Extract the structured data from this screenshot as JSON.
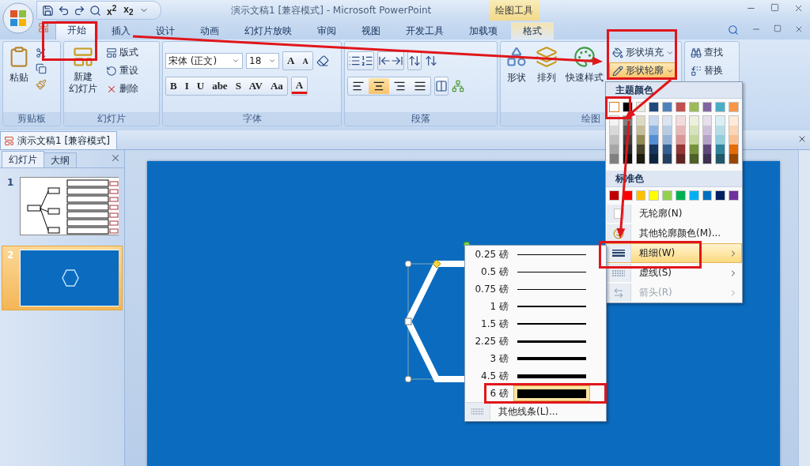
{
  "title_bar": {
    "quick_access": [
      "x$^{2}$",
      "x$_{2}$"
    ],
    "title": "演示文稿1 [兼容模式] - Microsoft PowerPoint",
    "context_group": "绘图工具"
  },
  "tabs": [
    {
      "label": "开始",
      "selected": true
    },
    {
      "label": "插入",
      "selected": false
    },
    {
      "label": "设计",
      "selected": false
    },
    {
      "label": "动画",
      "selected": false
    },
    {
      "label": "幻灯片放映",
      "selected": false
    },
    {
      "label": "审阅",
      "selected": false
    },
    {
      "label": "视图",
      "selected": false
    },
    {
      "label": "开发工具",
      "selected": false
    },
    {
      "label": "加载项",
      "selected": false
    },
    {
      "label": "格式",
      "selected": false,
      "kind": "context"
    }
  ],
  "ribbon": {
    "clipboard": {
      "label": "剪贴板",
      "paste": "粘贴"
    },
    "slides": {
      "label": "幻灯片",
      "new_slide": [
        "新建",
        "幻灯片"
      ],
      "layout": "版式",
      "reset": "重设",
      "delete": "删除"
    },
    "font": {
      "label": "字体",
      "font_name": "宋体 (正文)",
      "font_size": "18",
      "grow": "A",
      "shrink": "A",
      "buttons": [
        "B",
        "I",
        "U",
        "abe",
        "S",
        "AV",
        "Aa"
      ],
      "color_button": "A"
    },
    "paragraph": {
      "label": "段落",
      "alignment": [
        {
          "kind": "left",
          "selected": false
        },
        {
          "kind": "center",
          "selected": true
        },
        {
          "kind": "right",
          "selected": false
        },
        {
          "kind": "justify",
          "selected": false
        }
      ]
    },
    "drawing": {
      "label": "绘图",
      "shapes": "形状",
      "arrange": "排列",
      "quick_styles": "快速样式",
      "shape_fill": "形状填充",
      "shape_outline": "形状轮廓",
      "shape_outline_open": true
    },
    "editing": {
      "find": "查找",
      "replace": "替换"
    }
  },
  "document_tab": "演示文稿1 [兼容模式]",
  "slide_pane": {
    "tabs": [
      {
        "label": "幻灯片",
        "selected": true
      },
      {
        "label": "大纲",
        "selected": false
      }
    ],
    "slides": [
      {
        "number": "1",
        "kind": "diagram",
        "selected": false
      },
      {
        "number": "2",
        "kind": "shape",
        "selected": true
      }
    ]
  },
  "outline_menu": {
    "theme_heading": "主题颜色",
    "theme_colors": [
      {
        "color": "#ffffff",
        "selected": true,
        "shades": [
          {
            "color": "#f2f2f2"
          },
          {
            "color": "#d9d9d9"
          },
          {
            "color": "#bfbfbf"
          },
          {
            "color": "#a6a6a6"
          },
          {
            "color": "#808080"
          }
        ]
      },
      {
        "color": "#000000",
        "selected": false,
        "shades": [
          {
            "color": "#7f7f7f"
          },
          {
            "color": "#595959"
          },
          {
            "color": "#404040"
          },
          {
            "color": "#262626"
          },
          {
            "color": "#0d0d0d"
          }
        ]
      },
      {
        "color": "#eeece1",
        "selected": false,
        "shades": [
          {
            "color": "#ddd9c3"
          },
          {
            "color": "#c4bd97"
          },
          {
            "color": "#938953"
          },
          {
            "color": "#494429"
          },
          {
            "color": "#1d1b10"
          }
        ]
      },
      {
        "color": "#1f497d",
        "selected": false,
        "shades": [
          {
            "color": "#c6d9f0"
          },
          {
            "color": "#8db3e2"
          },
          {
            "color": "#548dd4"
          },
          {
            "color": "#17365d"
          },
          {
            "color": "#0f243e"
          }
        ]
      },
      {
        "color": "#4f81bd",
        "selected": false,
        "shades": [
          {
            "color": "#dbe5f1"
          },
          {
            "color": "#b8cce4"
          },
          {
            "color": "#95b3d7"
          },
          {
            "color": "#366092"
          },
          {
            "color": "#244061"
          }
        ]
      },
      {
        "color": "#c0504d",
        "selected": false,
        "shades": [
          {
            "color": "#f2dcdb"
          },
          {
            "color": "#e5b9b7"
          },
          {
            "color": "#d99694"
          },
          {
            "color": "#953734"
          },
          {
            "color": "#632423"
          }
        ]
      },
      {
        "color": "#9bbb59",
        "selected": false,
        "shades": [
          {
            "color": "#ebf1dd"
          },
          {
            "color": "#d7e3bc"
          },
          {
            "color": "#c3d69b"
          },
          {
            "color": "#76923c"
          },
          {
            "color": "#4f6128"
          }
        ]
      },
      {
        "color": "#8064a2",
        "selected": false,
        "shades": [
          {
            "color": "#e5e0ec"
          },
          {
            "color": "#ccc1d9"
          },
          {
            "color": "#b2a2c7"
          },
          {
            "color": "#5f497a"
          },
          {
            "color": "#3f3151"
          }
        ]
      },
      {
        "color": "#4bacc6",
        "selected": false,
        "shades": [
          {
            "color": "#dbeef3"
          },
          {
            "color": "#b7dde8"
          },
          {
            "color": "#92cddc"
          },
          {
            "color": "#31859b"
          },
          {
            "color": "#205867"
          }
        ]
      },
      {
        "color": "#f79646",
        "selected": false,
        "shades": [
          {
            "color": "#fdeada"
          },
          {
            "color": "#fbd5b5"
          },
          {
            "color": "#fac08f"
          },
          {
            "color": "#e36c09"
          },
          {
            "color": "#974806"
          }
        ]
      }
    ],
    "standard_heading": "标准色",
    "standard_colors": [
      {
        "color": "#c00000"
      },
      {
        "color": "#ff0000"
      },
      {
        "color": "#ffc000"
      },
      {
        "color": "#ffff00"
      },
      {
        "color": "#92d050"
      },
      {
        "color": "#00b050"
      },
      {
        "color": "#00b0f0"
      },
      {
        "color": "#0070c0"
      },
      {
        "color": "#002060"
      },
      {
        "color": "#7030a0"
      }
    ],
    "items": [
      {
        "label": "无轮廓(N)",
        "kind": "none",
        "highlighted": false,
        "disabled": false,
        "submenu": false
      },
      {
        "label": "其他轮廓颜色(M)...",
        "kind": "palette",
        "highlighted": false,
        "disabled": false,
        "submenu": false
      },
      {
        "label": "粗细(W)",
        "kind": "weight",
        "highlighted": true,
        "disabled": false,
        "submenu": true
      },
      {
        "label": "虚线(S)",
        "kind": "dash",
        "highlighted": false,
        "disabled": false,
        "submenu": true
      },
      {
        "label": "箭头(R)",
        "kind": "arrow",
        "highlighted": false,
        "disabled": true,
        "submenu": true
      }
    ]
  },
  "weight_menu": {
    "items": [
      {
        "label": "0.25 磅",
        "selected": false
      },
      {
        "label": "0.5 磅",
        "selected": false
      },
      {
        "label": "0.75 磅",
        "selected": false
      },
      {
        "label": "1 磅",
        "selected": false
      },
      {
        "label": "1.5 磅",
        "selected": false
      },
      {
        "label": "2.25 磅",
        "selected": false
      },
      {
        "label": "3 磅",
        "selected": false
      },
      {
        "label": "4.5 磅",
        "selected": false
      },
      {
        "label": "6 磅",
        "selected": true
      }
    ],
    "more": "其他线条(L)..."
  }
}
